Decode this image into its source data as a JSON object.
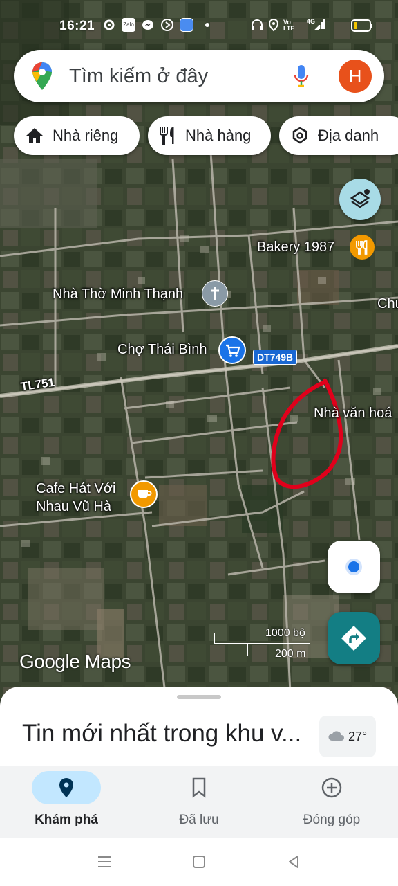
{
  "status_bar": {
    "time": "16:21",
    "icons": [
      "settings-icon",
      "zalo-icon",
      "messenger-icon",
      "circle-app-icon",
      "app-icon",
      "dot-icon",
      "headphones-icon",
      "location-icon",
      "volte-icon",
      "4g-signal-icon",
      "battery-icon"
    ],
    "volte": "Vo LTE",
    "network": "4G"
  },
  "search": {
    "placeholder": "Tìm kiếm ở đây",
    "avatar_letter": "H"
  },
  "chips": [
    {
      "label": "Nhà riêng",
      "icon": "home-icon"
    },
    {
      "label": "Nhà hàng",
      "icon": "restaurant-icon"
    },
    {
      "label": "Địa danh",
      "icon": "landmark-icon"
    }
  ],
  "map": {
    "labels": {
      "bakery": "Bakery 1987",
      "church": "Nhà Thờ Minh Thạnh",
      "market": "Chợ Thái Bình",
      "road_dt": "DT749B",
      "road_tl": "TL751",
      "cultural_house": "Nhà văn hoá",
      "cafe": "Cafe Hát Với Nhau Vũ Hà",
      "edge_label": "Chu"
    },
    "scale": {
      "feet": "1000 bộ",
      "meters": "200 m"
    },
    "watermark": "Google Maps",
    "colors": {
      "route_badge": "#1967d2",
      "annotation": "#e0001b",
      "pin_orange": "#f29900",
      "pin_blue": "#1a73e8",
      "pin_gray": "#8a9aa6"
    }
  },
  "bottom_sheet": {
    "title": "Tin mới nhất trong khu v...",
    "weather": "27°"
  },
  "bottom_nav": [
    {
      "label": "Khám phá",
      "icon": "explore-pin-icon",
      "active": true
    },
    {
      "label": "Đã lưu",
      "icon": "bookmark-icon",
      "active": false
    },
    {
      "label": "Đóng góp",
      "icon": "add-circle-icon",
      "active": false
    }
  ]
}
